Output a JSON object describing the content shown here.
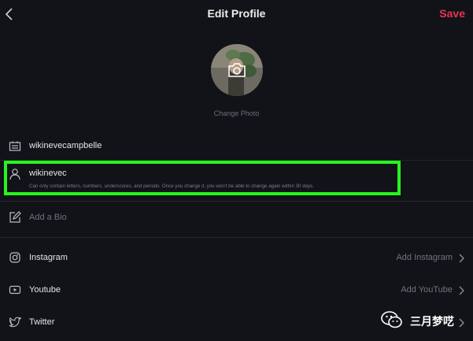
{
  "header": {
    "back_icon": "chevron-left-icon",
    "title": "Edit Profile",
    "save_label": "Save",
    "save_color": "#e8344f"
  },
  "photo": {
    "camera_icon": "camera-icon",
    "change_label": "Change Photo"
  },
  "fields": {
    "name": {
      "icon": "id-card-icon",
      "value": "wikinevecampbelle"
    },
    "username": {
      "icon": "user-icon",
      "value": "wikinevec",
      "hint": "Can only contain letters, numbers, underscores, and periods. Once you change it, you won't be able to change again within 30 days."
    },
    "bio": {
      "icon": "edit-icon",
      "placeholder": "Add a Bio"
    }
  },
  "social": {
    "instagram": {
      "icon": "instagram-icon",
      "label": "Instagram",
      "action": "Add Instagram"
    },
    "youtube": {
      "icon": "youtube-icon",
      "label": "Youtube",
      "action": "Add YouTube"
    },
    "twitter": {
      "icon": "twitter-icon",
      "label": "Twitter"
    }
  },
  "highlight_color": "#27f51f",
  "watermark": {
    "text": "三月梦呓"
  }
}
